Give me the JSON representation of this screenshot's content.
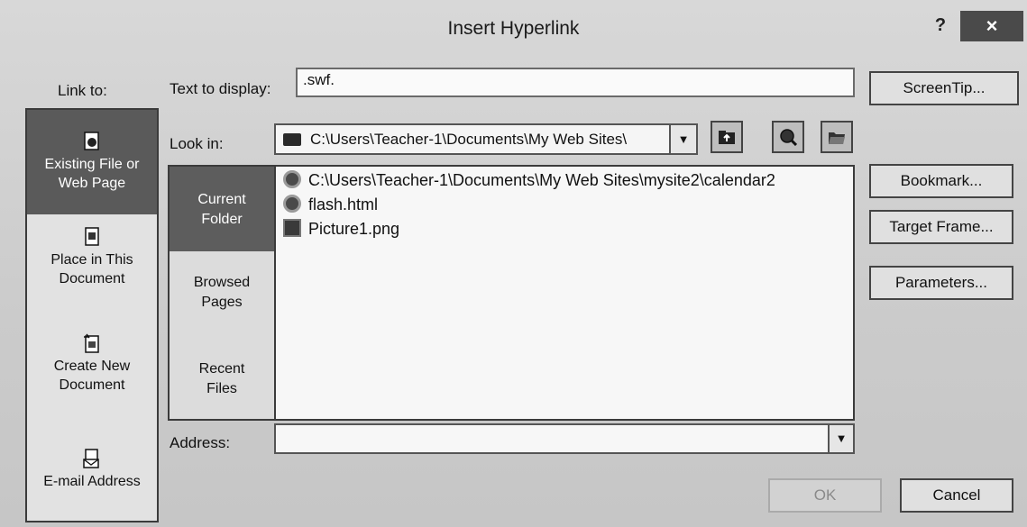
{
  "window": {
    "title": "Insert Hyperlink",
    "help": "?",
    "close": "×"
  },
  "link_to": {
    "label": "Link to:",
    "items": [
      {
        "label_line1": "Existing File or",
        "label_line2": "Web Page",
        "icon": "web-page-icon",
        "active": true
      },
      {
        "label_line1": "Place in This",
        "label_line2": "Document",
        "icon": "document-icon",
        "active": false
      },
      {
        "label_line1": "Create New",
        "label_line2": "Document",
        "icon": "new-document-icon",
        "active": false
      },
      {
        "label_line1": "E-mail Address",
        "label_line2": "",
        "icon": "email-icon",
        "active": false
      }
    ]
  },
  "text_to_display": {
    "label": "Text to display:",
    "value": ".swf."
  },
  "look_in": {
    "label": "Look in:",
    "value": "C:\\Users\\Teacher-1\\Documents\\My Web Sites\\",
    "toolbar": [
      "up-folder-icon",
      "browse-web-icon",
      "browse-file-icon"
    ]
  },
  "folder_tabs": [
    {
      "label_line1": "Current",
      "label_line2": "Folder",
      "active": true
    },
    {
      "label_line1": "Browsed",
      "label_line2": "Pages",
      "active": false
    },
    {
      "label_line1": "Recent",
      "label_line2": "Files",
      "active": false
    }
  ],
  "files": [
    {
      "name": "C:\\Users\\Teacher-1\\Documents\\My Web Sites\\mysite2\\calendar2",
      "icon": "web-page-icon"
    },
    {
      "name": "flash.html",
      "icon": "web-page-icon"
    },
    {
      "name": "Picture1.png",
      "icon": "image-icon"
    }
  ],
  "address": {
    "label": "Address:",
    "value": ""
  },
  "buttons": {
    "screentip": "ScreenTip...",
    "bookmark": "Bookmark...",
    "target_frame": "Target Frame...",
    "parameters": "Parameters...",
    "ok": "OK",
    "cancel": "Cancel"
  }
}
